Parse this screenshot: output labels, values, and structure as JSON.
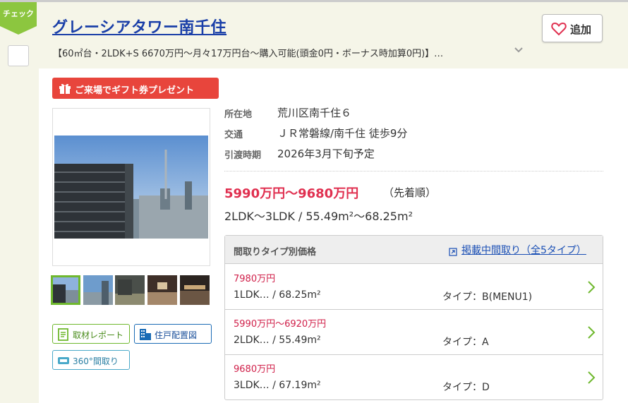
{
  "check": {
    "tab_label": "チェック"
  },
  "header": {
    "title": "グレーシアタワー南千住",
    "subtitle": "【60㎡台・2LDK+S 6670万円〜月々17万円台〜購入可能(頭金0円・ボーナス時加算0円)】…",
    "add_label": "追加"
  },
  "badge": {
    "label": "ご来場でギフト券プレゼント"
  },
  "buttons": {
    "report": "取材レポート",
    "layout": "住戸配置図",
    "tour": "360°間取り"
  },
  "info": {
    "location_label": "所在地",
    "location_value": "荒川区南千住６",
    "transit_label": "交通",
    "transit_value": "ＪＲ常磐線/南千住 徒歩9分",
    "delivery_label": "引渡時期",
    "delivery_value": "2026年3月下旬予定"
  },
  "price": {
    "range": "5990万円〜9680万円",
    "note": "（先着順）",
    "size_range": "2LDK〜3LDK / 55.49m²〜68.25m²"
  },
  "type_table": {
    "header_label": "間取りタイプ別価格",
    "header_link": "掲載中間取り（全5タイプ）",
    "rows": [
      {
        "price": "7980万円",
        "spec": "1LDK… / 68.25m²",
        "type": "タイプ：B(MENU1)"
      },
      {
        "price": "5990万円〜6920万円",
        "spec": "2LDK… / 55.49m²",
        "type": "タイプ：A"
      },
      {
        "price": "9680万円",
        "spec": "3LDK… / 67.19m²",
        "type": "タイプ：D"
      }
    ]
  },
  "colors": {
    "title": "#1a3fa8",
    "price": "#e03050",
    "badge": "#e8453c",
    "check_tab": "#8cc63f",
    "arrow": "#6fb82e"
  }
}
